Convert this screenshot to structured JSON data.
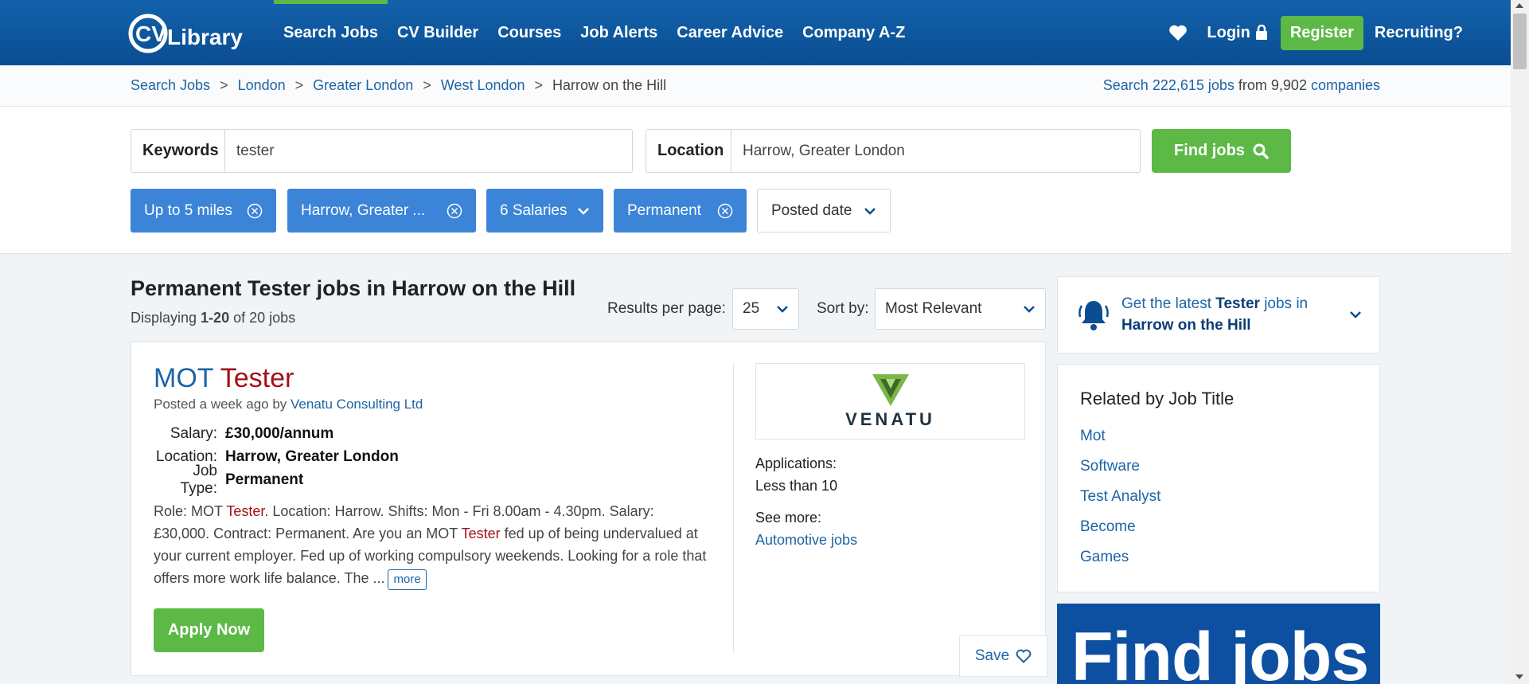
{
  "header": {
    "logo_text": "CV Library",
    "nav": [
      "Search Jobs",
      "CV Builder",
      "Courses",
      "Job Alerts",
      "Career Advice",
      "Company A-Z"
    ],
    "login": "Login",
    "register": "Register",
    "recruiting": "Recruiting?",
    "brand_green": "#5cb946",
    "brand_blue": "#0b4d92"
  },
  "breadcrumb": {
    "items": [
      "Search Jobs",
      "London",
      "Greater London",
      "West London"
    ],
    "current": "Harrow on the Hill",
    "sep": ">"
  },
  "search_stats": {
    "prefix": "Search 222,615 jobs",
    "middle": " from 9,902 ",
    "suffix": "companies"
  },
  "search": {
    "keywords_label": "Keywords",
    "keywords_value": "tester",
    "location_label": "Location",
    "location_value": "Harrow, Greater London",
    "find_button": "Find jobs"
  },
  "filters": [
    {
      "label": "Up to 5 miles",
      "icon": "close-circle-icon"
    },
    {
      "label": "Harrow, Greater ...",
      "icon": "close-circle-icon"
    },
    {
      "label": "6 Salaries",
      "icon": "chevron-down-icon"
    },
    {
      "label": "Permanent",
      "icon": "close-circle-icon"
    },
    {
      "label": "Posted date",
      "icon": "chevron-down-icon"
    }
  ],
  "results": {
    "title": "Permanent Tester jobs in Harrow on the Hill",
    "count_prefix": "Displaying ",
    "count_range": "1-20",
    "count_suffix": " of 20 jobs",
    "per_page_label": "Results per page:",
    "per_page_value": "25",
    "sort_label": "Sort by:",
    "sort_value": "Most Relevant"
  },
  "job": {
    "title_word1": "MOT ",
    "title_word2": "Tester",
    "posted_prefix": "Posted a week ago by ",
    "company": "Venatu Consulting Ltd",
    "salary_label": "Salary:",
    "salary": "£30,000/annum",
    "location_label": "Location:",
    "location": "Harrow, Greater London",
    "type_label": "Job Type:",
    "type": "Permanent",
    "desc_1": "Role: MOT ",
    "desc_hl1": "Tester",
    "desc_2": ". Location: Harrow. Shifts: Mon - Fri 8.00am - 4.30pm. Salary: £30,000. Contract: Permanent. Are you an MOT ",
    "desc_hl2": "Tester",
    "desc_3": " fed up of being undervalued at your current employer. Fed up of working compulsory weekends. Looking for a role that offers more work life balance. The ...",
    "more": "more",
    "apply": "Apply Now",
    "company_logo_text": "VENATU",
    "applications_label": "Applications:",
    "applications_value": "Less than 10",
    "see_more_label": "See more:",
    "see_more_link": "Automotive jobs",
    "save": "Save"
  },
  "sidebar": {
    "alert_prefix": "Get the latest ",
    "alert_bold": "Tester",
    "alert_mid": " jobs in ",
    "alert_place": "Harrow on the Hill",
    "related_title": "Related by Job Title",
    "related": [
      "Mot",
      "Software",
      "Test Analyst",
      "Become",
      "Games"
    ],
    "banner_text": "Find jobs"
  }
}
